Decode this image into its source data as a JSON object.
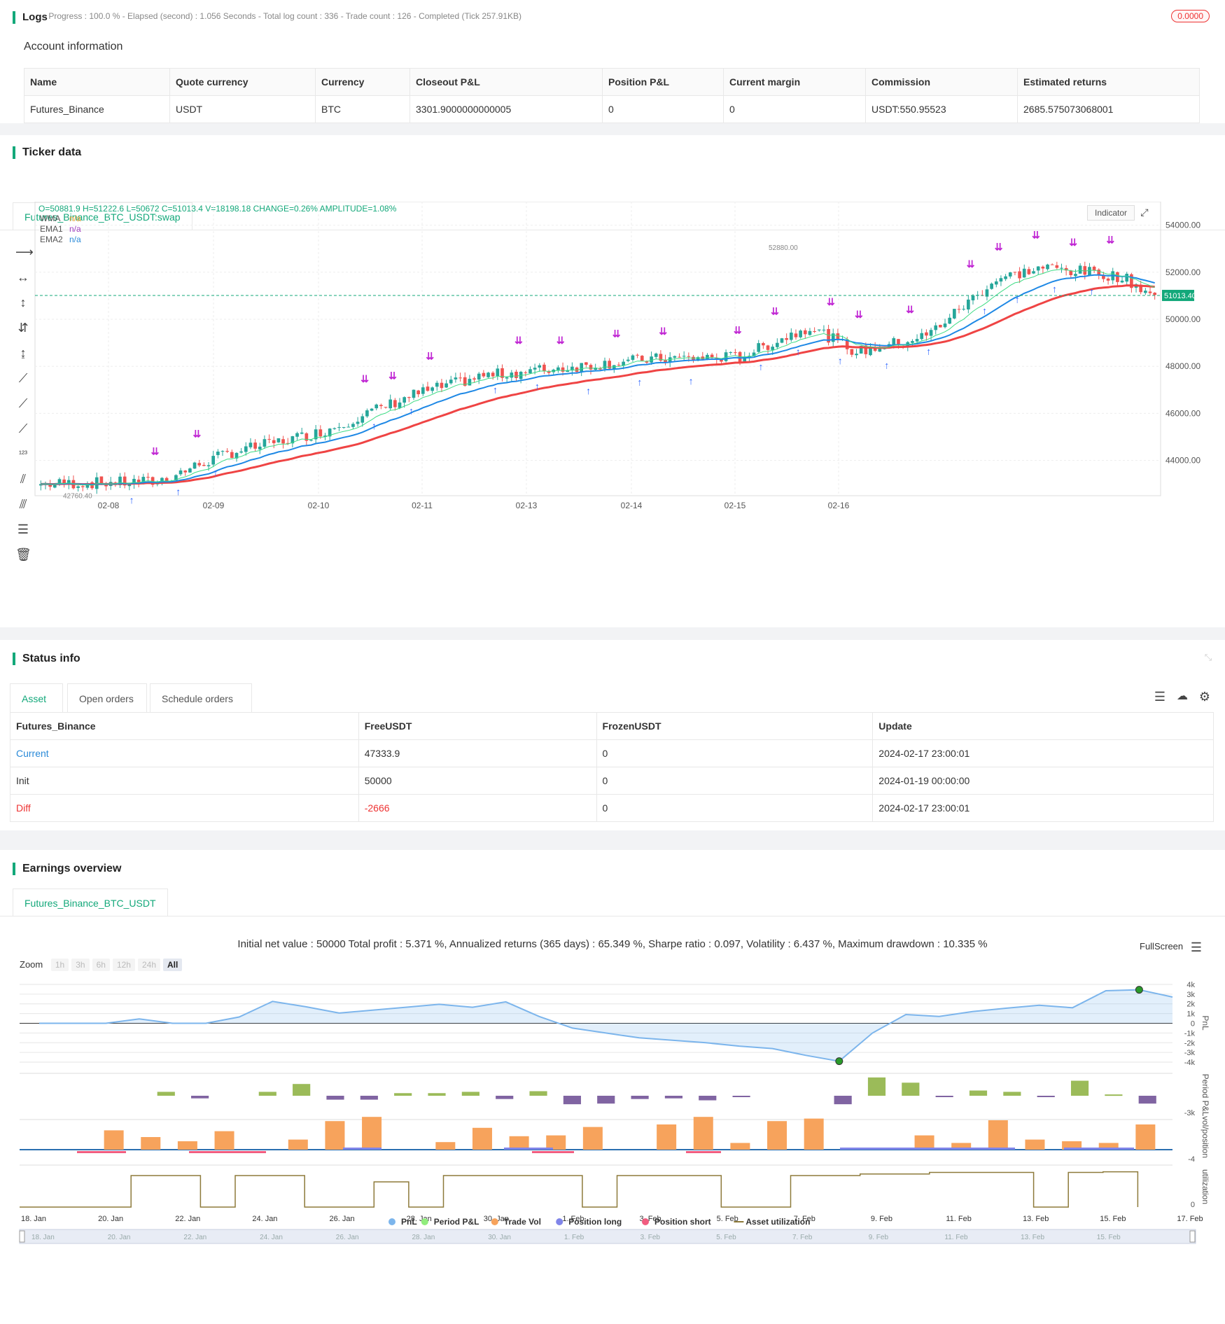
{
  "logs": {
    "title": "Logs",
    "status": "- Progress : 100.0 % - Elapsed (second) : 1.056 Seconds - Total log count : 336 - Trade count : 126 - Completed (Tick 257.91KB)",
    "badge": "0.0000"
  },
  "account": {
    "title": "Account information",
    "headers": [
      "Name",
      "Quote currency",
      "Currency",
      "Closeout P&L",
      "Position P&L",
      "Current margin",
      "Commission",
      "Estimated returns"
    ],
    "row": [
      "Futures_Binance",
      "USDT",
      "BTC",
      "3301.9000000000005",
      "0",
      "0",
      "USDT:550.95523",
      "2685.575073068001"
    ]
  },
  "ticker": {
    "title": "Ticker data",
    "tab": "Futures_Binance_BTC_USDT:swap",
    "ohlc": "O=50881.9 H=51222.6 L=50672 C=51013.4 V=18198.18 CHANGE=0.26% AMPLITUDE=1.08%",
    "legend": [
      {
        "name": "WMA",
        "value": "n/a",
        "color": "#f0a030"
      },
      {
        "name": "EMA1",
        "value": "n/a",
        "color": "#a040c0"
      },
      {
        "name": "EMA2",
        "value": "n/a",
        "color": "#2a8ad8"
      }
    ],
    "indicator_btn": "Indicator",
    "price_label": "51013.40",
    "y_ticks": [
      "54000.00",
      "52000.00",
      "50000.00",
      "48000.00",
      "46000.00",
      "44000.00"
    ],
    "x_ticks": [
      "02-08",
      "02-09",
      "02-10",
      "02-11",
      "02-13",
      "02-14",
      "02-15",
      "02-16"
    ],
    "low_label": "42760.40",
    "high_label": "52880.00",
    "colors": {
      "up": "#26a69a",
      "down": "#ef5350",
      "wma": "#ef4444",
      "ema1": "#3ddc84",
      "ema2": "#1e88e5",
      "marker_buy": "#2962ff",
      "marker_close": "#c026d3"
    }
  },
  "status": {
    "title": "Status info",
    "tabs": [
      "Asset",
      "Open orders",
      "Schedule orders"
    ],
    "headers": [
      "Futures_Binance",
      "FreeUSDT",
      "FrozenUSDT",
      "Update"
    ],
    "rows": [
      [
        "Current",
        "47333.9",
        "0",
        "2024-02-17 23:00:01"
      ],
      [
        "Init",
        "50000",
        "0",
        "2024-01-19 00:00:00"
      ],
      [
        "Diff",
        "-2666",
        "0",
        "2024-02-17 23:00:01"
      ]
    ]
  },
  "earnings": {
    "title": "Earnings overview",
    "tab": "Futures_Binance_BTC_USDT",
    "summary": "Initial net value : 50000 Total profit : 5.371 %, Annualized returns (365 days) : 65.349 %, Sharpe ratio : 0.097, Volatility : 6.437 %, Maximum drawdown : 10.335 %",
    "fullscreen": "FullScreen",
    "zoom_label": "Zoom",
    "zoom_buttons": [
      "1h",
      "3h",
      "6h",
      "12h",
      "24h",
      "All"
    ],
    "pnl_ticks": [
      "4k",
      "3k",
      "2k",
      "1k",
      "0",
      "-1k",
      "-2k",
      "-3k",
      "-4k"
    ],
    "period_tick": "-3k",
    "vol_tick": "-4",
    "util_tick": "0",
    "axis_titles": [
      "PnL",
      "Period P&L",
      "vol/position",
      "utilization"
    ],
    "x_dates": [
      "18. Jan",
      "20. Jan",
      "22. Jan",
      "24. Jan",
      "26. Jan",
      "28. Jan",
      "30. Jan",
      "1. Feb",
      "3. Feb",
      "5. Feb",
      "7. Feb",
      "9. Feb",
      "11. Feb",
      "13. Feb",
      "15. Feb",
      "17. Feb"
    ],
    "nav_dates": [
      "18. Jan",
      "20. Jan",
      "22. Jan",
      "24. Jan",
      "26. Jan",
      "28. Jan",
      "30. Jan",
      "1. Feb",
      "3. Feb",
      "5. Feb",
      "7. Feb",
      "9. Feb",
      "11. Feb",
      "13. Feb",
      "15. Feb"
    ],
    "legend": [
      {
        "name": "PnL",
        "color": "#7cb5ec"
      },
      {
        "name": "Period P&L",
        "color": "#90ed7d"
      },
      {
        "name": "Trade Vol",
        "color": "#f7a35c"
      },
      {
        "name": "Position long",
        "color": "#8085e9"
      },
      {
        "name": "Position short",
        "color": "#f15c80"
      },
      {
        "name": "Asset utilization",
        "color": "#8d7a3a"
      }
    ],
    "pnl_series": [
      0,
      0,
      0,
      450,
      0,
      0,
      650,
      2250,
      1700,
      1050,
      1350,
      1650,
      1950,
      1650,
      2200,
      700,
      -500,
      -1000,
      -1500,
      -1750,
      -2000,
      -2350,
      -2600,
      -3300,
      -3900,
      -1000,
      900,
      700,
      1200,
      1550,
      1850,
      1600,
      3350,
      3450,
      2700
    ],
    "period_pnl": [
      0,
      0,
      300,
      -200,
      0,
      300,
      900,
      -300,
      -300,
      200,
      200,
      300,
      -250,
      350,
      -650,
      -600,
      -250,
      -200,
      -350,
      -100,
      0,
      0,
      -650,
      1400,
      1000,
      -100,
      400,
      300,
      -100,
      1150,
      100,
      -600
    ],
    "trade_vol": [
      0,
      2.3,
      1.5,
      1.0,
      2.2,
      0,
      1.2,
      3.4,
      3.9,
      0,
      0.9,
      2.6,
      1.6,
      1.7,
      2.7,
      0,
      3.0,
      3.9,
      0.8,
      3.4,
      3.7,
      0.2,
      0,
      1.7,
      0.8,
      3.5,
      1.2,
      1.0,
      0.8,
      3.0
    ],
    "utilization": [
      0,
      0,
      1,
      1,
      0,
      1,
      1,
      0,
      0,
      0.8,
      0,
      1,
      1,
      1,
      1,
      0,
      1,
      1,
      1,
      0,
      0,
      1,
      1,
      1.05,
      1.05,
      1.1,
      1.1,
      1.1,
      0,
      1.1,
      1.12,
      0
    ]
  }
}
